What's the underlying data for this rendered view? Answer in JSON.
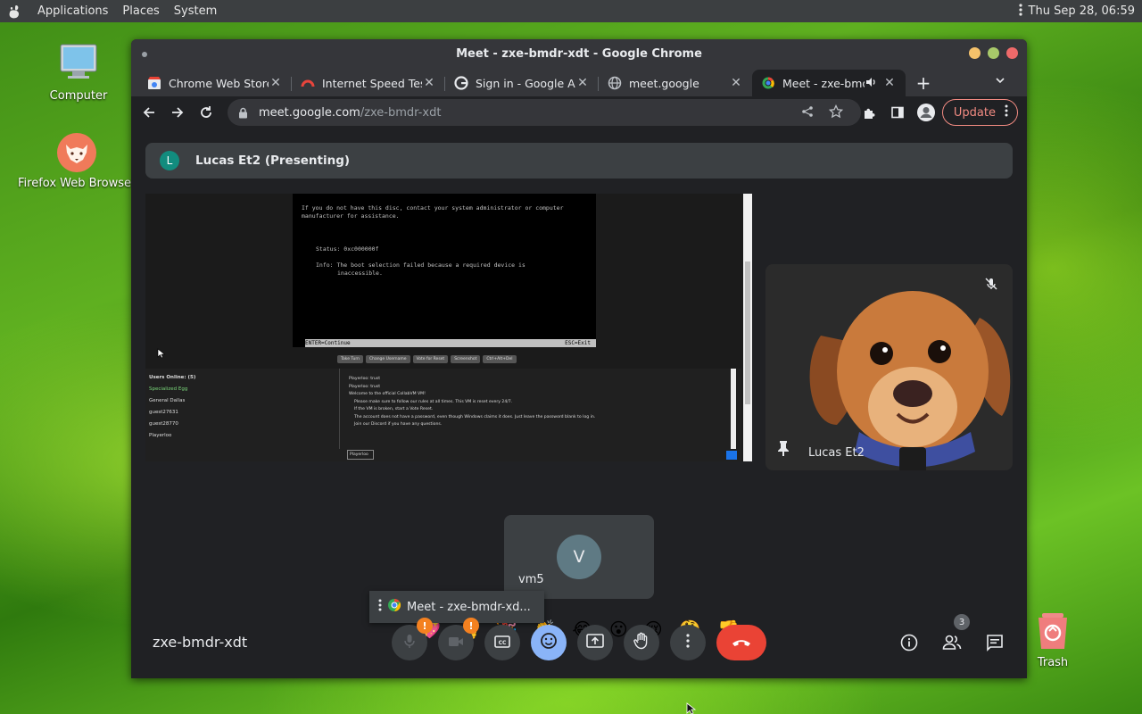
{
  "topbar": {
    "menus": [
      "Applications",
      "Places",
      "System"
    ],
    "clock": "Thu Sep 28, 06:59"
  },
  "desktop": {
    "computer_label": "Computer",
    "firefox_label": "Firefox Web Browser",
    "trash_label": "Trash"
  },
  "window": {
    "title": "Meet - zxe-bmdr-xdt - Google Chrome",
    "tabs": [
      {
        "title": "Chrome Web Store",
        "icon": "chrome-web-store-icon"
      },
      {
        "title": "Internet Speed Test",
        "icon": "speedtest-icon"
      },
      {
        "title": "Sign in - Google Accounts",
        "icon": "google-icon"
      },
      {
        "title": "meet.google",
        "icon": "globe-icon"
      },
      {
        "title": "Meet - zxe-bmdr-xdt",
        "icon": "meet-icon",
        "active": true
      }
    ],
    "url_host": "meet.google.com",
    "url_path": "/zxe-bmdr-xdt",
    "update_label": "Update"
  },
  "meet": {
    "presenter_initial": "L",
    "presenter_banner": "Lucas Et2 (Presenting)",
    "share": {
      "bsod_lines": [
        "If you do not have this disc, contact your system administrator or computer",
        "manufacturer for assistance.",
        "",
        "",
        "    Status: 0xc000000f",
        "",
        "    Info: The boot selection failed because a required device is",
        "          inaccessible."
      ],
      "bsod_footer_left": "ENTER=Continue",
      "bsod_footer_right": "ESC=Exit",
      "vm_buttons": [
        "Take Turn",
        "Change Username",
        "Vote for Reset",
        "Screenshot",
        "Ctrl+Alt+Del"
      ],
      "users_header": "Users Online: (5)",
      "users": [
        "Specialized Egg",
        "General Dallas",
        "guest27631",
        "guest28770",
        "Playerloo"
      ],
      "chat_lines": [
        "Playerloo: trust",
        "Playerloo: trust",
        "Welcome to the official CollabVM VM!",
        "Please make sure to follow our rules at all times. This VM is reset every 24/7.",
        "If the VM is broken, start a Vote Reset.",
        "The account does not have a password, even though Windows claims it does. Just leave the password blank to log in.",
        "Join our Discord if you have any questions."
      ],
      "chat_input": "Playerloo"
    },
    "tile_vm5": {
      "initial": "V",
      "name": "vm5"
    },
    "tile_lucas": {
      "name": "Lucas Et2"
    },
    "share_chip": "Meet - zxe-bmdr-xd...",
    "reactions": [
      "💖",
      "👍",
      "🎉",
      "👏",
      "😂",
      "😮",
      "😢",
      "🤔",
      "👎"
    ],
    "meeting_code": "zxe-bmdr-xdt",
    "warn_mark": "!",
    "people_count": "3"
  },
  "colors": {
    "end_call": "#ea4335",
    "emoji_button": "#8ab4f8",
    "warning": "#f48120",
    "update_accent": "#f28b82"
  }
}
